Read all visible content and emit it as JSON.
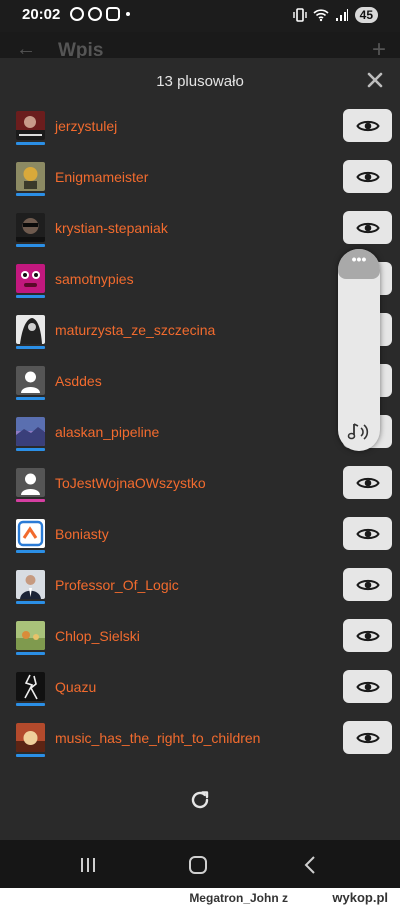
{
  "status_bar": {
    "time": "20:02",
    "battery": "45",
    "notification_icons": [
      "whatsapp-icon",
      "messenger-icon",
      "screenshot-icon"
    ],
    "right_icons": [
      "vibrate-icon",
      "wifi-icon",
      "signal-icon"
    ]
  },
  "behind_screen": {
    "title": "Wpis"
  },
  "sheet": {
    "title": "13 plusowało",
    "users": [
      {
        "name": "jerzystulej",
        "underline_color": "#2b8fe6"
      },
      {
        "name": "Enigmameister",
        "underline_color": "#2b8fe6"
      },
      {
        "name": "krystian-stepaniak",
        "underline_color": "#2b8fe6"
      },
      {
        "name": "samotnypies",
        "underline_color": "#2b8fe6"
      },
      {
        "name": "maturzysta_ze_szczecina",
        "underline_color": "#2b8fe6"
      },
      {
        "name": "Asddes",
        "underline_color": "#2b8fe6"
      },
      {
        "name": "alaskan_pipeline",
        "underline_color": "#2b8fe6"
      },
      {
        "name": "ToJestWojnaOWszystko",
        "underline_color": "#d63fa2"
      },
      {
        "name": "Boniasty",
        "underline_color": "#2b8fe6"
      },
      {
        "name": "Professor_Of_Logic",
        "underline_color": "#2b8fe6"
      },
      {
        "name": "Chlop_Sielski",
        "underline_color": "#2b8fe6"
      },
      {
        "name": "Quazu",
        "underline_color": "#2b8fe6"
      },
      {
        "name": "music_has_the_right_to_children",
        "underline_color": "#2b8fe6"
      }
    ]
  },
  "volume_panel": {
    "menu_label": "•••"
  },
  "footer": {
    "user": "Megatron_John",
    "suffix": "z",
    "logo": "wykop.pl"
  },
  "colors": {
    "accent": "#f26b2e",
    "sheet_bg": "#2a2a2a",
    "button_bg": "#e6e6e6"
  }
}
